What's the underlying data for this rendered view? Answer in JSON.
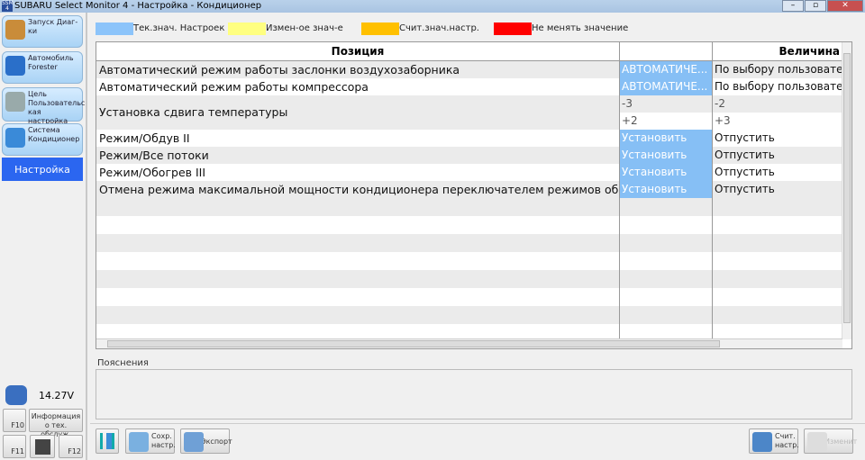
{
  "window": {
    "title": "SUBARU Select Monitor 4 - Настройка - Кондиционер",
    "logo": "SSM4"
  },
  "sidebar": {
    "items": [
      {
        "label": "Запуск Диаг-ки",
        "icon": "house-icon"
      },
      {
        "label": "Автомобиль Forester",
        "icon": "car-check-icon"
      },
      {
        "label": "Цель Пользовательс кая настройка",
        "icon": "magnifier-graph-icon"
      },
      {
        "label": "Система Кондиционер",
        "icon": "aircon-arrows-icon"
      },
      {
        "label": "Настройка"
      }
    ],
    "voltage": "14.27V",
    "info_button": "Информация о тех. обслуж.",
    "fkeys": [
      "F10",
      "F11",
      "F12"
    ]
  },
  "legend": [
    {
      "label": "Тек.знач. Настроек",
      "color": "#8cc4fa"
    },
    {
      "label": "Измен-ое знач-е",
      "color": "#ffff80"
    },
    {
      "label": "Счит.знач.настр.",
      "color": "#ffc000"
    },
    {
      "label": "Не менять значение",
      "color": "#ff0000"
    }
  ],
  "table": {
    "headers": [
      "Позиция",
      "Величина"
    ],
    "rows": [
      {
        "name": "Автоматический режим работы заслонки воздухозаборника",
        "v1": "АВТОМАТИЧЕ...",
        "v2": "По выбору пользовател"
      },
      {
        "name": "Автоматический режим работы компрессора",
        "v1": "АВТОМАТИЧЕ...",
        "v2": "По выбору пользовател"
      },
      {
        "name": "Установка сдвига температуры",
        "v1": "-3",
        "v2": "-2",
        "v1b": "+2",
        "v2b": "+3"
      },
      {
        "name": "Режим/Обдув II",
        "v1": "Установить",
        "v2": "Отпустить"
      },
      {
        "name": "Режим/Все потоки",
        "v1": "Установить",
        "v2": "Отпустить"
      },
      {
        "name": "Режим/Обогрев III",
        "v1": "Установить",
        "v2": "Отпустить"
      },
      {
        "name": "Отмена режима максимальной мощности кондиционера переключателем режимов обдува",
        "v1": "Установить",
        "v2": "Отпустить"
      }
    ]
  },
  "notes": {
    "label": "Пояснения"
  },
  "buttons": {
    "save": "Сохр. настр.",
    "export": "Экспорт",
    "read": "Счит. настр.",
    "change": "Изменит"
  }
}
